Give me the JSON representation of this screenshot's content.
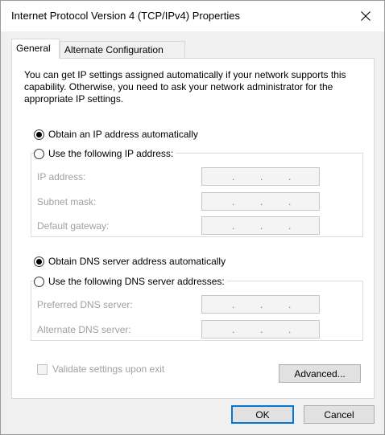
{
  "window": {
    "title": "Internet Protocol Version 4 (TCP/IPv4) Properties"
  },
  "tabs": [
    {
      "label": "General",
      "active": true
    },
    {
      "label": "Alternate Configuration",
      "active": false
    }
  ],
  "general": {
    "description": "You can get IP settings assigned automatically if your network supports this capability. Otherwise, you need to ask your network administrator for the appropriate IP settings.",
    "ip_auto_label": "Obtain an IP address automatically",
    "ip_manual_label": "Use the following IP address:",
    "ip_fields": {
      "ip_address": "IP address:",
      "subnet_mask": "Subnet mask:",
      "default_gateway": "Default gateway:"
    },
    "dns_auto_label": "Obtain DNS server address automatically",
    "dns_manual_label": "Use the following DNS server addresses:",
    "dns_fields": {
      "preferred": "Preferred DNS server:",
      "alternate": "Alternate DNS server:"
    },
    "ip_dot": ".",
    "validate_label": "Validate settings upon exit",
    "advanced_label": "Advanced..."
  },
  "buttons": {
    "ok": "OK",
    "cancel": "Cancel"
  },
  "state": {
    "ip_mode": "automatic",
    "dns_mode": "automatic",
    "validate_checked": false
  },
  "colors": {
    "accent": "#0078d7",
    "disabled_text": "#a0a0a0"
  }
}
